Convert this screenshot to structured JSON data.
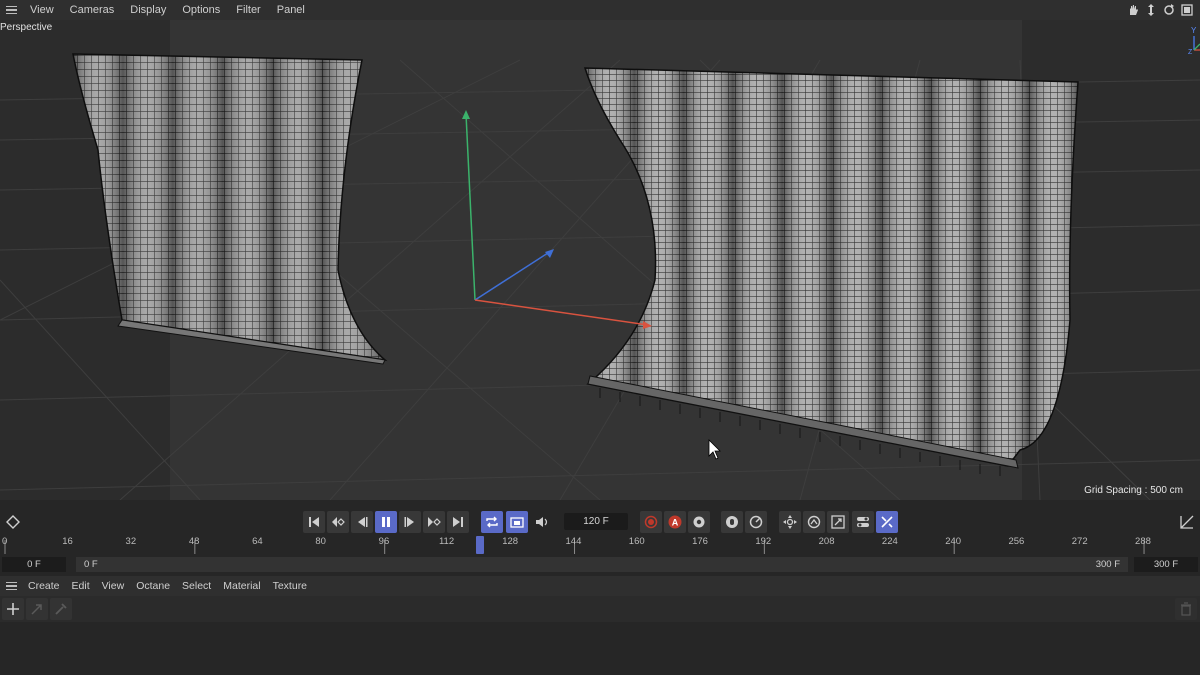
{
  "viewport_menu": {
    "items": [
      "View",
      "Cameras",
      "Display",
      "Options",
      "Filter",
      "Panel"
    ]
  },
  "viewport": {
    "camera_label": "Perspective",
    "grid_spacing": "Grid Spacing : 500 cm",
    "gizmo_y": "Y",
    "gizmo_x": "X",
    "gizmo_z": "Z"
  },
  "timeline": {
    "current_frame": "120 F",
    "auto_key_letter": "A",
    "ruler_ticks": [
      "0",
      "16",
      "32",
      "48",
      "64",
      "80",
      "96",
      "112",
      "128",
      "144",
      "160",
      "176",
      "192",
      "208",
      "224",
      "240",
      "256",
      "272",
      "288"
    ],
    "playhead_frame": 120,
    "range_start": "0 F",
    "range_min": "0 F",
    "range_max": "300 F",
    "range_end": "300 F"
  },
  "material_menu": {
    "items": [
      "Create",
      "Edit",
      "View",
      "Octane",
      "Select",
      "Material",
      "Texture"
    ]
  },
  "colors": {
    "accent": "#5a6ac7",
    "record": "#c0392b",
    "axis_x": "#d9533f",
    "axis_y": "#3bb36b",
    "axis_z": "#3f6fd6"
  }
}
